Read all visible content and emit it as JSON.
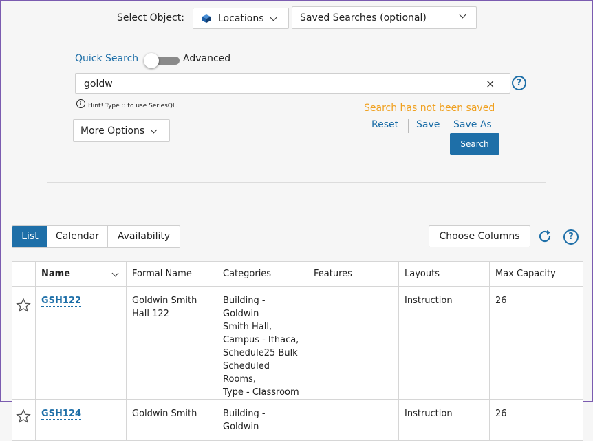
{
  "select_object": {
    "label": "Select Object:",
    "value": "Locations"
  },
  "saved_searches": {
    "value": "Saved Searches (optional)"
  },
  "quick_search": {
    "label": "Quick Search",
    "advanced_label": "Advanced"
  },
  "search": {
    "value": "goldw",
    "hint": "Hint! Type :: to use SeriesQL."
  },
  "more_options": {
    "label": "More Options"
  },
  "status": {
    "not_saved": "Search has not been saved"
  },
  "actions": {
    "reset": "Reset",
    "save": "Save",
    "save_as": "Save As",
    "search": "Search"
  },
  "view_tabs": [
    "List",
    "Calendar",
    "Availability"
  ],
  "choose_columns": "Choose Columns",
  "colors": {
    "accent": "#1e6fa8",
    "warning": "#f0a01e"
  },
  "table": {
    "headers": [
      "Name",
      "Formal Name",
      "Categories",
      "Features",
      "Layouts",
      "Max Capacity"
    ],
    "rows": [
      {
        "name": "GSH122",
        "formal": [
          "Goldwin Smith",
          "Hall 122"
        ],
        "categories": [
          "Building - Goldwin",
          "Smith Hall,",
          "Campus - Ithaca,",
          "Schedule25 Bulk",
          "Scheduled Rooms,",
          "Type - Classroom"
        ],
        "features": "",
        "layouts": "Instruction",
        "capacity": "26"
      },
      {
        "name": "GSH124",
        "formal": [
          "Goldwin Smith"
        ],
        "categories": [
          "Building - Goldwin"
        ],
        "features": "",
        "layouts": "Instruction",
        "capacity": "26"
      }
    ]
  }
}
